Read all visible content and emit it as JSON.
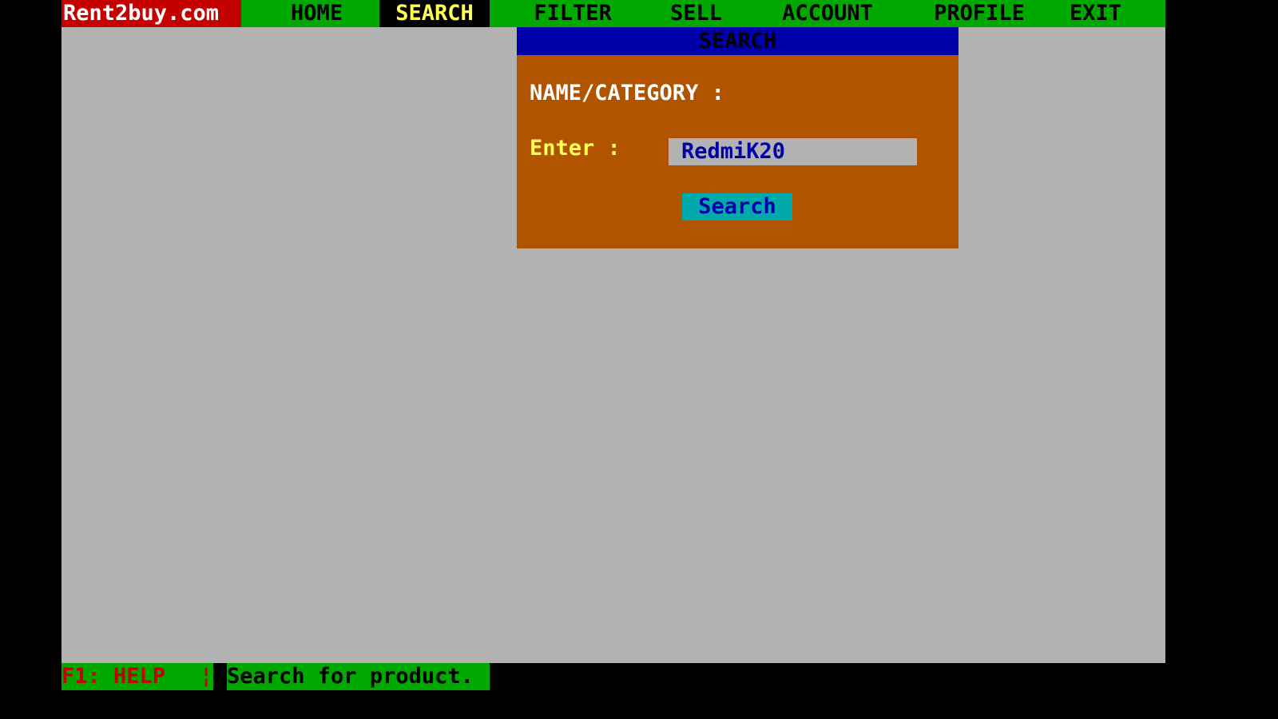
{
  "app": {
    "brand": "Rent2buy.com"
  },
  "menu": {
    "items": [
      {
        "label": "HOME"
      },
      {
        "label": "SEARCH"
      },
      {
        "label": "FILTER"
      },
      {
        "label": "SELL"
      },
      {
        "label": "ACCOUNT"
      },
      {
        "label": "PROFILE"
      },
      {
        "label": "EXIT"
      }
    ],
    "active": "SEARCH"
  },
  "dialog": {
    "title": "SEARCH",
    "field_label": "NAME/CATEGORY :",
    "enter_label": "Enter :",
    "input_value": "RedmiK20",
    "button_label": "Search"
  },
  "status": {
    "help_key": "F1: HELP",
    "separator": "¦",
    "message": "Search for product."
  },
  "colors": {
    "menubar": "#00a800",
    "brand_bg": "#c40000",
    "desktop": "#b2b2b2",
    "dialog_bg": "#b05400",
    "dialog_title_bg": "#0000aa",
    "button_bg": "#00aaaa",
    "active_menu_text": "#ffff55"
  }
}
